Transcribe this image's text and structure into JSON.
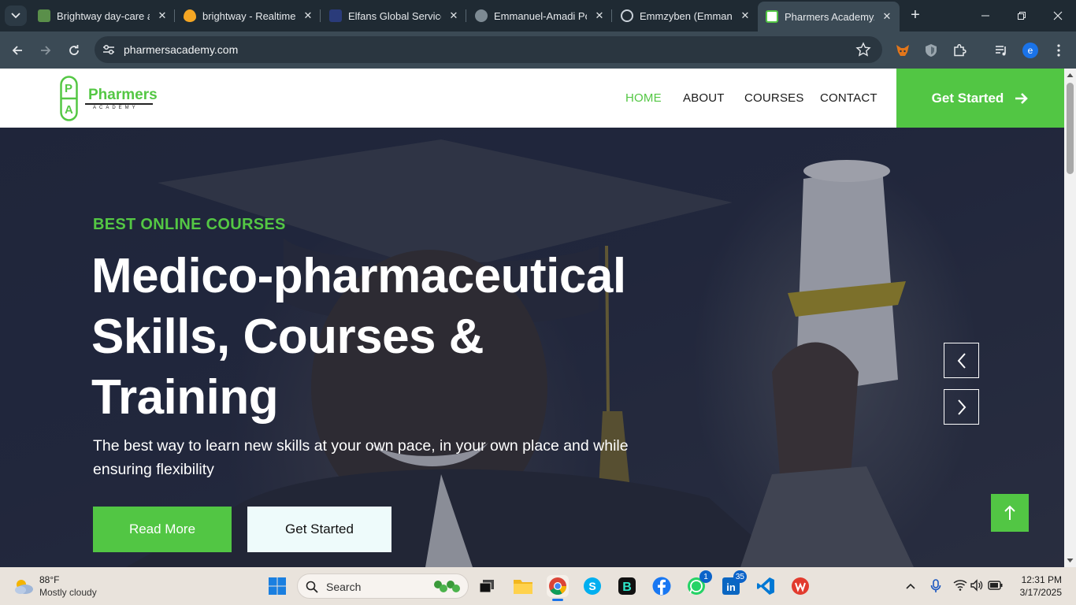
{
  "browser": {
    "tabs": [
      {
        "title": "Brightway day-care ac",
        "favicon": "brightway-icon",
        "color": "#5a8f4a"
      },
      {
        "title": "brightway - Realtime",
        "favicon": "firebase-icon",
        "color": "#f5a623"
      },
      {
        "title": "Elfans Global Services",
        "favicon": "elfans-icon",
        "color": "#2a3b7a"
      },
      {
        "title": "Emmanuel-Amadi Po",
        "favicon": "globe-icon",
        "color": "#7d8a93"
      },
      {
        "title": "Emmzyben (Emmanu",
        "favicon": "github-icon",
        "color": "#c9d1d9"
      },
      {
        "title": "Pharmers AcademyA",
        "favicon": "pharmers-icon",
        "color": "#52c644"
      }
    ],
    "active_tab": 5,
    "url": "pharmersacademy.com",
    "profile_initial": "e"
  },
  "site": {
    "logo": {
      "letters": [
        "P",
        "A"
      ],
      "name": "Pharmers",
      "sub": "ACADEMY"
    },
    "nav": [
      {
        "label": "HOME",
        "active": true
      },
      {
        "label": "ABOUT",
        "active": false
      },
      {
        "label": "COURSES",
        "active": false
      },
      {
        "label": "CONTACT",
        "active": false
      }
    ],
    "header_cta": "Get Started",
    "accent": "#52c644"
  },
  "hero": {
    "kicker": "BEST ONLINE COURSES",
    "headline_lines": [
      "Medico-pharmaceutical",
      "Skills, Courses &",
      "Training"
    ],
    "subtext": "The best way to learn new skills at your own pace, in your own place and while ensuring flexibility",
    "primary_button": "Read More",
    "secondary_button": "Get Started"
  },
  "taskbar": {
    "weather_temp": "88°F",
    "weather_desc": "Mostly cloudy",
    "search_placeholder": "Search",
    "whatsapp_badge": "1",
    "linkedin_badge": "35",
    "time": "12:31 PM",
    "date": "3/17/2025"
  }
}
